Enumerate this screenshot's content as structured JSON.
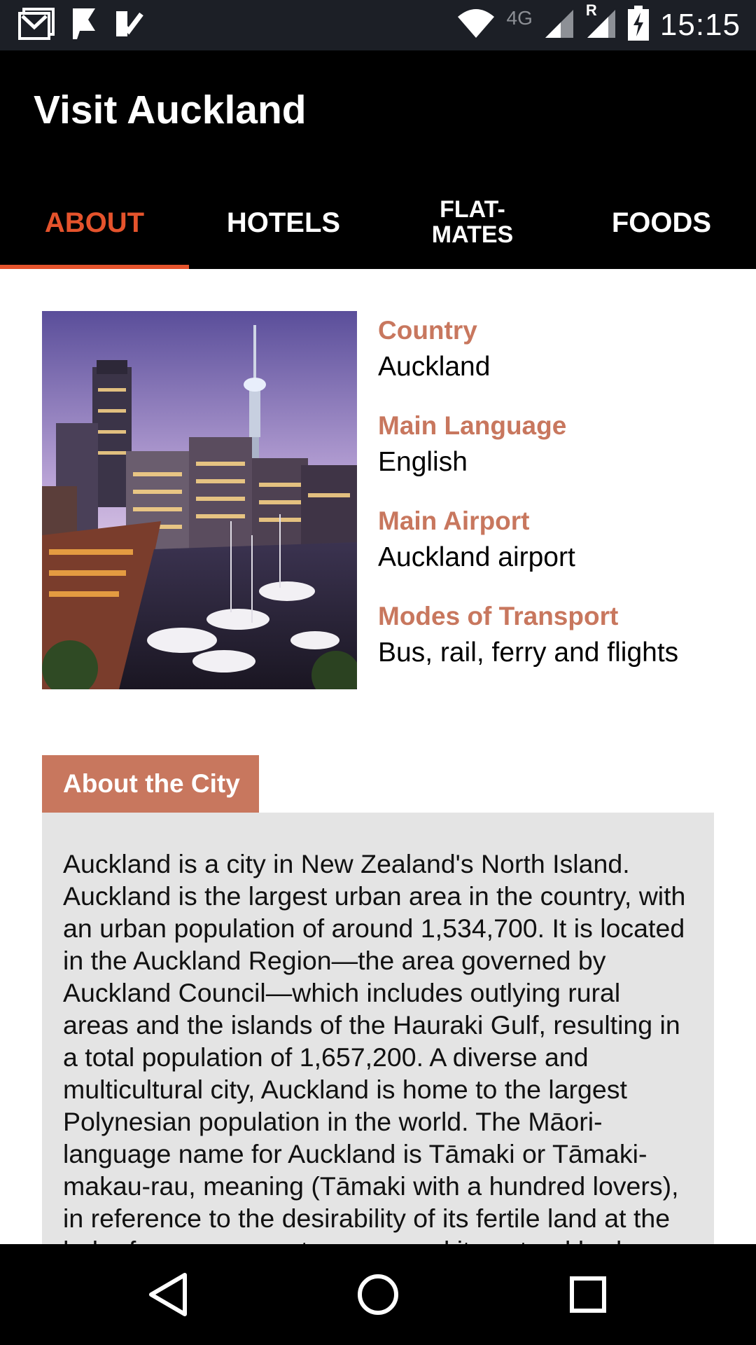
{
  "status_bar": {
    "time": "15:15",
    "network": "4G",
    "roaming": "R",
    "left_icons": [
      "gmail-icon",
      "flag-app-icon",
      "checkmark-app-icon"
    ],
    "right_icons": [
      "wifi-icon",
      "signal-icon",
      "signal-roaming-icon",
      "battery-charging-icon"
    ]
  },
  "app": {
    "title": "Visit Auckland"
  },
  "tabs": [
    {
      "label": "ABOUT",
      "active": true
    },
    {
      "label": "HOTELS",
      "active": false
    },
    {
      "label": "FLAT-\nMATES",
      "active": false
    },
    {
      "label": "FOODS",
      "active": false
    }
  ],
  "info": [
    {
      "label": "Country",
      "value": "Auckland"
    },
    {
      "label": "Main Language",
      "value": "English"
    },
    {
      "label": "Main Airport",
      "value": "Auckland airport"
    },
    {
      "label": "Modes of Transport",
      "value": "Bus, rail, ferry and flights"
    }
  ],
  "about": {
    "heading": "About the City",
    "text": "Auckland is a city in New Zealand's North Island. Auckland is the largest urban area in the country, with an urban population of around 1,534,700. It is located in the Auckland Region—the area governed by Auckland Council—which includes outlying rural areas and the islands of the Hauraki Gulf, resulting in a total population of 1,657,200. A diverse and multicultural city, Auckland is home to the largest Polynesian population in the world. The Māori-language name for Auckland is Tāmaki or Tāmaki-makau-rau, meaning (Tāmaki with a hundred lovers), in reference to the desirability of its fertile land at the hub of numerous waterways, and its natural harbours."
  },
  "nav_bar": {
    "icons": [
      "back-icon",
      "home-icon",
      "recents-icon"
    ]
  },
  "colors": {
    "accent": "#e5532c",
    "label": "#c8775e",
    "app_bar": "#000000",
    "status_bar": "#1c1f26",
    "about_box": "#e4e4e4"
  }
}
